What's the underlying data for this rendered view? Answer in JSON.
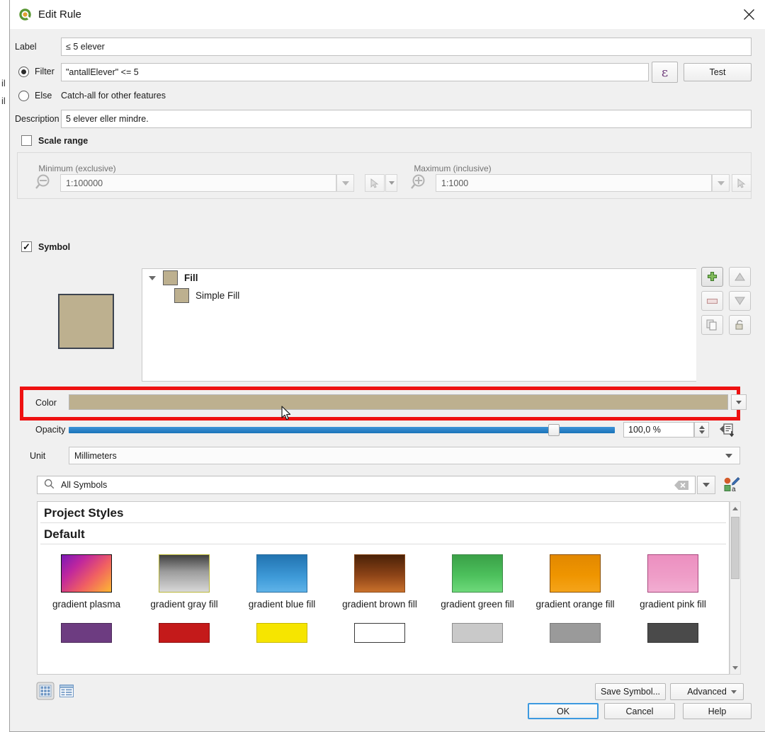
{
  "window": {
    "title": "Edit Rule",
    "app_icon": "qgis-icon",
    "close_icon": "close-icon"
  },
  "behind": {
    "glyph1": "il",
    "glyph2": "il"
  },
  "rule": {
    "label_caption": "Label",
    "label_value": "≤ 5 elever",
    "filter_caption": "Filter",
    "filter_value": "\"antallElever\" <= 5",
    "filter_selected": true,
    "expression_button_glyph": "ε",
    "test_button": "Test",
    "else_caption": "Else",
    "else_description": "Catch-all for other features",
    "description_caption": "Description",
    "description_value": "5 elever eller mindre."
  },
  "scale_range": {
    "caption": "Scale range",
    "checked": false,
    "minimum_caption": "Minimum (exclusive)",
    "minimum_value": "1:100000",
    "maximum_caption": "Maximum (inclusive)",
    "maximum_value": "1:1000"
  },
  "symbol": {
    "caption": "Symbol",
    "checked": true,
    "check_glyph": "✓",
    "preview_color": "#bdb08f",
    "layers": [
      {
        "name": "Fill",
        "color": "#bdb08f",
        "bold": true
      },
      {
        "name": "Simple Fill",
        "color": "#bdb08f",
        "bold": false
      }
    ],
    "side_buttons": [
      "add-symbol-layer-button",
      "move-up-button",
      "remove-symbol-layer-button",
      "move-down-button",
      "duplicate-symbol-layer-button",
      "lock-layer-button"
    ]
  },
  "color_row": {
    "caption": "Color",
    "value_hex": "#bdb08f",
    "highlight_color": "#ee1111"
  },
  "opacity_row": {
    "caption": "Opacity",
    "value": "100,0 %",
    "slider_percent": 100
  },
  "unit_row": {
    "caption": "Unit",
    "value": "Millimeters"
  },
  "search": {
    "placeholder": "All Symbols",
    "value": "All Symbols",
    "clear_icon": "clear-icon",
    "dropdown_icon": "chevron-down-icon",
    "style_manager_icon": "style-manager-icon"
  },
  "gallery": {
    "groups": [
      {
        "title": "Project Styles"
      },
      {
        "title": "Default"
      }
    ],
    "row1": [
      {
        "label": "gradient  plasma",
        "css": "linear-gradient(135deg,#7b18b6 0%,#c0279d 30%,#f05f62 62%,#fdb832 100%)",
        "border": "#111111"
      },
      {
        "label": "gradient  gray fill",
        "css": "linear-gradient(180deg,#3f3f3f 0%,#9c9c9c 45%,#d8d8d8 100%)",
        "border": "#b9b637"
      },
      {
        "label": "gradient blue fill",
        "css": "linear-gradient(180deg,#2273b0 0%,#3e9ad8 60%,#5fb3e8 100%)",
        "border": "#2a6d9e"
      },
      {
        "label": "gradient brown fill",
        "css": "linear-gradient(180deg,#4a2208 0%,#8d4317 55%,#c9712b 100%)",
        "border": "#8a4a1c"
      },
      {
        "label": "gradient green fill",
        "css": "linear-gradient(180deg,#3aa047 0%,#4cc05c 55%,#6ed97a 100%)",
        "border": "#3f8b49"
      },
      {
        "label": "gradient orange fill",
        "css": "linear-gradient(180deg,#e28800 0%,#ef9500 55%,#f5a41a 100%)",
        "border": "#8a5008"
      },
      {
        "label": "gradient pink fill",
        "css": "linear-gradient(180deg,#ec8fc0 0%,#ef9ec8 60%,#f2add2 100%)",
        "border": "#a8497e"
      }
    ],
    "row2": [
      {
        "css": "#6d3c81",
        "border": "#4b2a59"
      },
      {
        "css": "#c41a1a",
        "border": "#8e1111"
      },
      {
        "css": "#f6e500",
        "border": "#c9ba00"
      },
      {
        "css": "#ffffff",
        "border": "#3a3a3a"
      },
      {
        "css": "#c9c9c9",
        "border": "#8d8d8d"
      },
      {
        "css": "#9a9a9a",
        "border": "#7a7a7a"
      },
      {
        "css": "#4a4a4a",
        "border": "#333333"
      }
    ]
  },
  "footer": {
    "view_grid_icon": "grid-view-icon",
    "view_list_icon": "list-view-icon",
    "save_symbol": "Save Symbol...",
    "advanced": "Advanced",
    "ok": "OK",
    "cancel": "Cancel",
    "help": "Help"
  }
}
